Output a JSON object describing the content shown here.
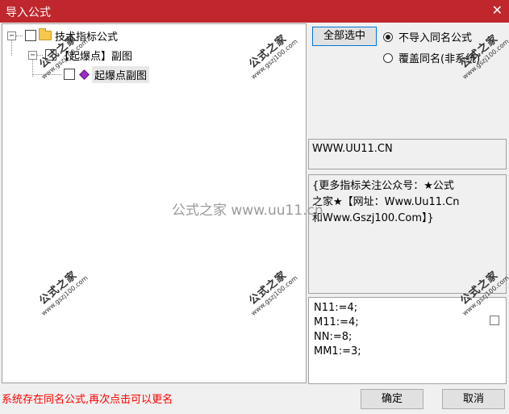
{
  "window": {
    "title": "导入公式",
    "close_glyph": "✕"
  },
  "tree": {
    "root": {
      "expander": "−",
      "label": "技术指标公式"
    },
    "child": {
      "expander": "−",
      "label": "【起爆点】副图"
    },
    "leaf": {
      "label": "起爆点副图"
    }
  },
  "controls": {
    "select_all_label": "全部选中",
    "radio_skip_label": "不导入同名公式",
    "radio_overwrite_label": "覆盖同名(非系统)",
    "radio_selected": "skip"
  },
  "url_text": "WWW.UU11.CN",
  "description": {
    "line1": "{更多指标关注公众号：★公式",
    "line2": "之家★【网址：Www.Uu11.Cn",
    "line3": "和Www.Gszj100.Com】}"
  },
  "code_lines": [
    "N11:=4;",
    "M11:=4;",
    "NN:=8;",
    "MM1:=3;"
  ],
  "status_message": "系统存在同名公式,再次点击可以更名",
  "buttons": {
    "ok_label": "确定",
    "cancel_label": "取消"
  },
  "watermark": {
    "name": "公式之家",
    "url": "www.gszj100.com",
    "center_text": "公式之家 www.uu11.cn"
  }
}
